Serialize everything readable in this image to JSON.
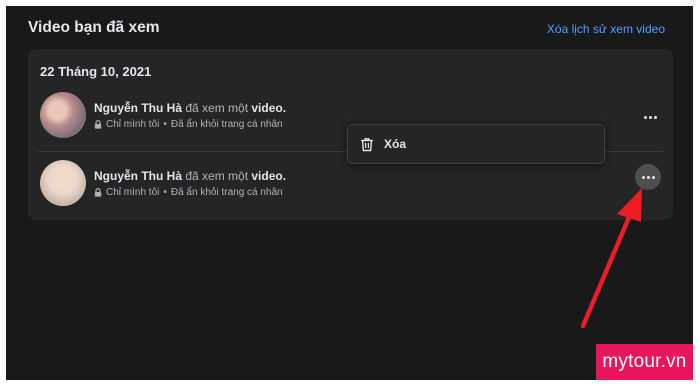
{
  "header": {
    "title": "Video bạn đã xem",
    "clear_history_label": "Xóa lịch sử xem video"
  },
  "history": {
    "date": "22 Tháng 10, 2021",
    "items": [
      {
        "name": "Nguyễn Thu Hà",
        "action": " đã xem một ",
        "object": "video.",
        "privacy": "Chỉ mình tôi",
        "separator": "•",
        "status": "Đã ẩn khỏi trang cá nhân"
      },
      {
        "name": "Nguyễn Thu Hà",
        "action": " đã xem một ",
        "object": "video.",
        "privacy": "Chỉ mình tôi",
        "separator": "•",
        "status": "Đã ẩn khỏi trang cá nhân"
      }
    ]
  },
  "menu": {
    "delete_label": "Xóa"
  },
  "watermark": "mytour.vn",
  "colors": {
    "background": "#18191a",
    "card": "#242526",
    "link": "#4ea1ff",
    "arrow": "#ee1c25",
    "watermark": "#e8175d"
  },
  "icons": [
    "lock-icon",
    "more-icon",
    "trash-icon"
  ]
}
